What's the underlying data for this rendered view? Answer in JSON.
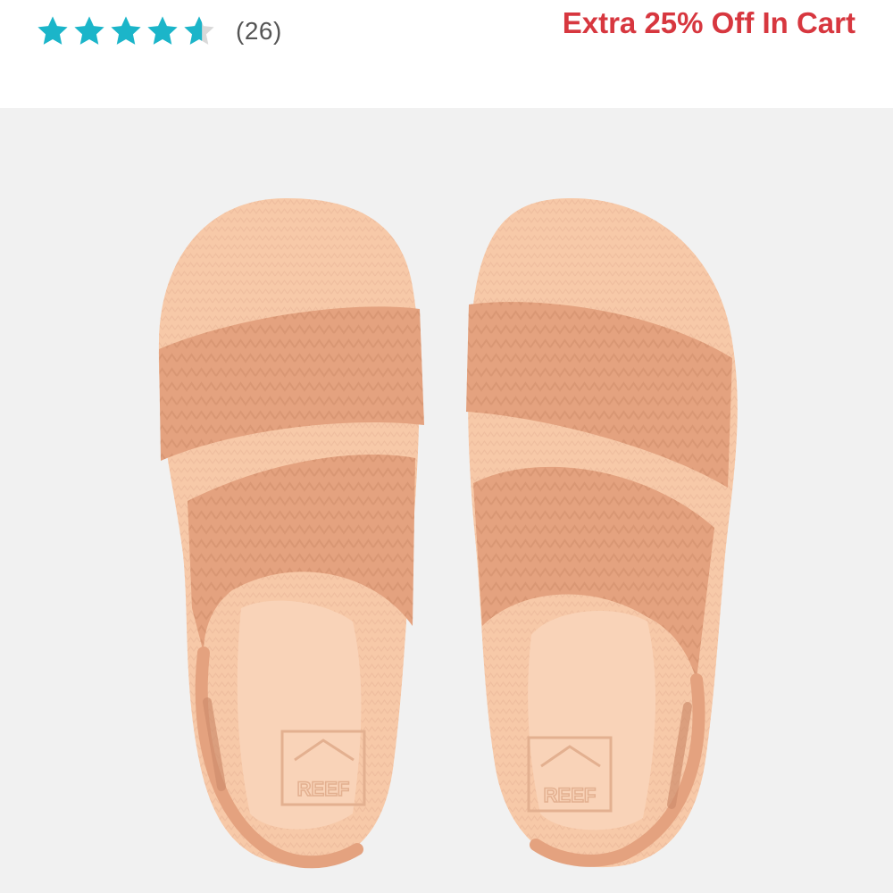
{
  "rating": {
    "value": 4.6,
    "max": 5,
    "review_count": "(26)",
    "star_color": "#1bb5c9",
    "empty_star_color": "#d9d9d9"
  },
  "promo": {
    "text": "Extra 25% Off In Cart",
    "color": "#d7373f"
  },
  "product_image": {
    "description_icon": "sandals-product-photo",
    "logo_text": "REEF",
    "colors": {
      "background": "#f1f1f1",
      "footbed": "#f7c9a8",
      "strap": "#e4a27f",
      "strap_dark": "#cf8d6c"
    }
  }
}
